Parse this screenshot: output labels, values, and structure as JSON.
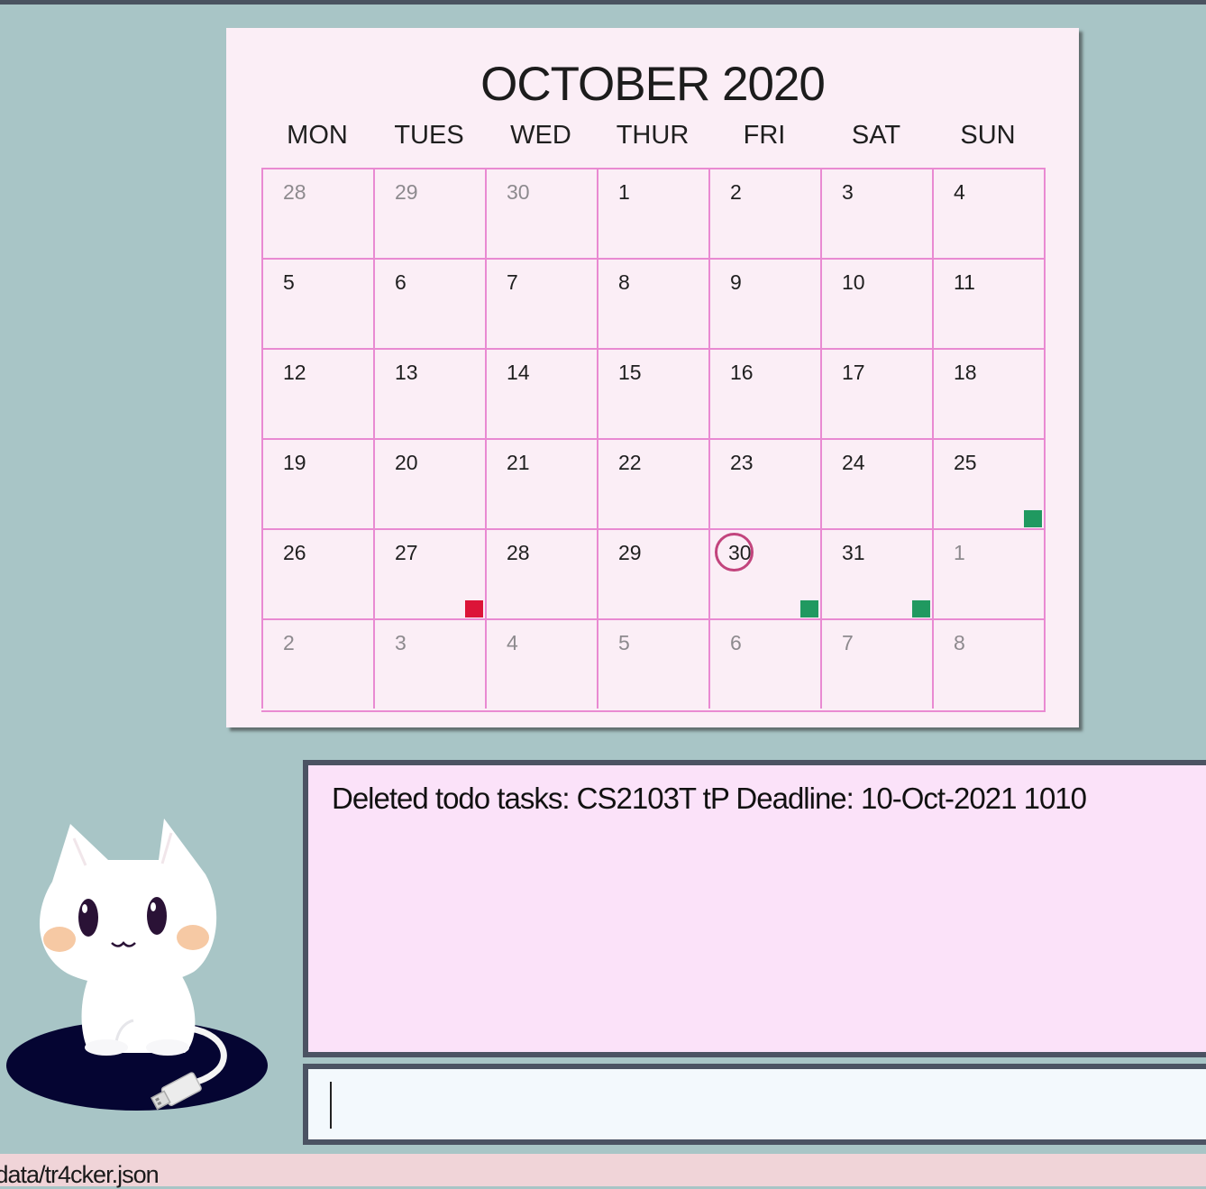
{
  "calendar": {
    "title": "OCTOBER 2020",
    "weekdays": [
      "MON",
      "TUES",
      "WED",
      "THUR",
      "FRI",
      "SAT",
      "SUN"
    ],
    "weeks": [
      [
        {
          "d": "28",
          "other": true
        },
        {
          "d": "29",
          "other": true
        },
        {
          "d": "30",
          "other": true
        },
        {
          "d": "1"
        },
        {
          "d": "2"
        },
        {
          "d": "3"
        },
        {
          "d": "4"
        }
      ],
      [
        {
          "d": "5"
        },
        {
          "d": "6"
        },
        {
          "d": "7"
        },
        {
          "d": "8"
        },
        {
          "d": "9"
        },
        {
          "d": "10"
        },
        {
          "d": "11"
        }
      ],
      [
        {
          "d": "12"
        },
        {
          "d": "13"
        },
        {
          "d": "14"
        },
        {
          "d": "15"
        },
        {
          "d": "16"
        },
        {
          "d": "17"
        },
        {
          "d": "18"
        }
      ],
      [
        {
          "d": "19"
        },
        {
          "d": "20"
        },
        {
          "d": "21"
        },
        {
          "d": "22"
        },
        {
          "d": "23"
        },
        {
          "d": "24"
        },
        {
          "d": "25",
          "marker": "done"
        }
      ],
      [
        {
          "d": "26"
        },
        {
          "d": "27",
          "marker": "todo"
        },
        {
          "d": "28"
        },
        {
          "d": "29"
        },
        {
          "d": "30",
          "today": true,
          "marker": "done"
        },
        {
          "d": "31",
          "marker": "done"
        },
        {
          "d": "1",
          "other": true
        }
      ],
      [
        {
          "d": "2",
          "other": true
        },
        {
          "d": "3",
          "other": true
        },
        {
          "d": "4",
          "other": true
        },
        {
          "d": "5",
          "other": true
        },
        {
          "d": "6",
          "other": true
        },
        {
          "d": "7",
          "other": true
        },
        {
          "d": "8",
          "other": true
        }
      ]
    ]
  },
  "result": {
    "text": "Deleted todo tasks: CS2103T tP Deadline: 10-Oct-2021 1010"
  },
  "command": {
    "value": ""
  },
  "status_bar": {
    "path": "/data/tr4cker.json"
  },
  "colors": {
    "background": "#a8c5c6",
    "calendar_bg": "#fbeef6",
    "grid_line": "#e98ad2",
    "today_ring": "#c2447d",
    "marker_done": "#209960",
    "marker_todo": "#dc1438",
    "result_bg": "#fbe2f9",
    "panel_border": "#4b5363",
    "status_bg": "#f0d4d8"
  },
  "icons": {
    "mascot": "cat-mascot-icon"
  }
}
